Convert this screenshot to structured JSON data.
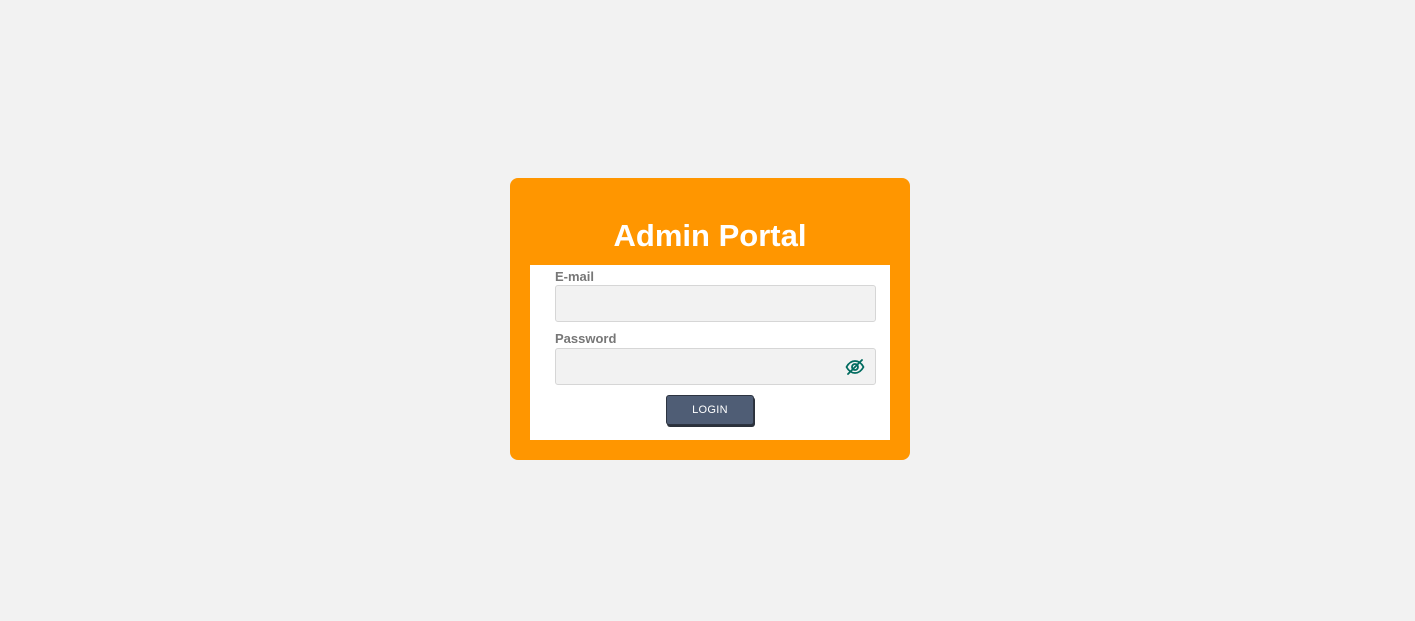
{
  "card": {
    "title": "Admin Portal",
    "background_color": "#ff9600"
  },
  "form": {
    "email": {
      "label": "E-mail",
      "value": "",
      "placeholder": ""
    },
    "password": {
      "label": "Password",
      "value": "",
      "placeholder": "",
      "toggle_icon": "eye-slash-icon",
      "toggle_color": "#006b5f"
    },
    "submit_label": "LOGIN",
    "submit_color": "#4f5d75"
  }
}
